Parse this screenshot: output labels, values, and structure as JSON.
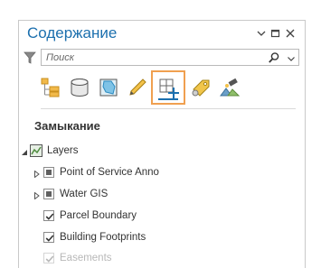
{
  "pane": {
    "title": "Содержание",
    "header_buttons": [
      "chevron-down-icon",
      "restore-icon",
      "close-icon"
    ]
  },
  "search": {
    "placeholder": "Поиск",
    "icons": [
      "filter-icon",
      "search-icon",
      "chevron-down-icon"
    ]
  },
  "toolbar": {
    "tools": [
      {
        "icon": "list-by-drawing-order-icon"
      },
      {
        "icon": "list-by-data-source-icon"
      },
      {
        "icon": "list-by-selection-icon"
      },
      {
        "icon": "list-by-editing-icon"
      },
      {
        "icon": "list-by-snapping-icon",
        "selected": true
      },
      {
        "icon": "list-by-labeling-icon"
      },
      {
        "icon": "list-by-perspective-icon"
      }
    ],
    "accent": "#f0a050",
    "underline": "#1b6fae"
  },
  "section": {
    "title": "Замыкание"
  },
  "tree": {
    "root": {
      "label": "Layers",
      "icon": "map-icon",
      "expanded": true
    },
    "layers": [
      {
        "label": "Point of Service Anno",
        "expandable": true,
        "checked": "indeterminate"
      },
      {
        "label": "Water GIS",
        "expandable": true,
        "checked": "indeterminate"
      },
      {
        "label": "Parcel Boundary",
        "expandable": false,
        "checked": true
      },
      {
        "label": "Building Footprints",
        "expandable": false,
        "checked": true
      },
      {
        "label": "Easements",
        "expandable": false,
        "checked": true
      }
    ]
  },
  "colors": {
    "title": "#1b6fae",
    "border": "#c9c9c9"
  }
}
